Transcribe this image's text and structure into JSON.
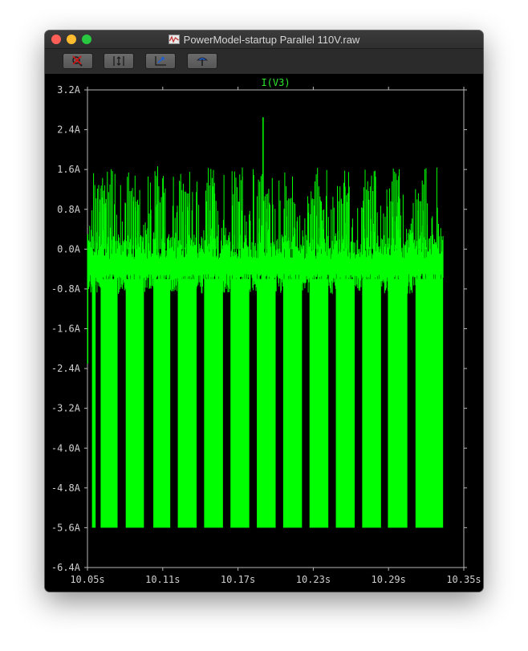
{
  "window": {
    "title": "PowerModel-startup Parallel 110V.raw"
  },
  "toolbar": {
    "buttons": [
      {
        "icon": "zoom-cancel-icon"
      },
      {
        "icon": "autoscale-icon"
      },
      {
        "icon": "pan-icon"
      },
      {
        "icon": "probe-icon"
      }
    ]
  },
  "chart_data": {
    "type": "line",
    "title": "I(V3)",
    "xlabel": "",
    "ylabel": "",
    "xlim": [
      10.05,
      10.35
    ],
    "ylim": [
      -6.4,
      3.2
    ],
    "x_ticks": [
      "10.05s",
      "10.11s",
      "10.17s",
      "10.23s",
      "10.29s",
      "10.35s"
    ],
    "y_ticks": [
      "3.2A",
      "2.4A",
      "1.6A",
      "0.8A",
      "0.0A",
      "-0.8A",
      "-1.6A",
      "-2.4A",
      "-3.2A",
      "-4.0A",
      "-4.8A",
      "-5.6A",
      "-6.4A"
    ],
    "grid": false,
    "series": [
      {
        "name": "I(V3)",
        "color": "#00ff00",
        "x": [
          10.05,
          10.0536,
          10.0565,
          10.074,
          10.0744,
          10.0805,
          10.095,
          10.0954,
          10.1025,
          10.116,
          10.1164,
          10.122,
          10.137,
          10.1374,
          10.143,
          10.158,
          10.1584,
          10.164,
          10.179,
          10.1794,
          10.185,
          10.2,
          10.2004,
          10.206,
          10.221,
          10.2214,
          10.227,
          10.242,
          10.2424,
          10.248,
          10.263,
          10.2634,
          10.269,
          10.284,
          10.2844,
          10.2895,
          10.305,
          10.3054,
          10.3115,
          10.3335
        ],
        "y": [
          -2.3,
          1.5,
          -5.6,
          1.7,
          -0.5,
          -5.6,
          1.8,
          -0.6,
          -5.6,
          1.8,
          -0.7,
          -5.6,
          1.6,
          -0.7,
          -5.6,
          1.6,
          -0.7,
          -5.6,
          2.65,
          -0.7,
          -5.6,
          1.6,
          -0.7,
          -5.6,
          1.7,
          -0.7,
          -5.6,
          1.5,
          -0.7,
          -5.6,
          1.5,
          -0.7,
          -5.6,
          1.4,
          -0.7,
          -5.6,
          1.6,
          -0.7,
          -5.6,
          0.2
        ],
        "burst_windows": [
          [
            10.0536,
            10.0565
          ],
          [
            10.0605,
            10.074
          ],
          [
            10.0805,
            10.095
          ],
          [
            10.1025,
            10.116
          ],
          [
            10.122,
            10.137
          ],
          [
            10.143,
            10.158
          ],
          [
            10.164,
            10.179
          ],
          [
            10.185,
            10.2
          ],
          [
            10.206,
            10.221
          ],
          [
            10.227,
            10.242
          ],
          [
            10.248,
            10.263
          ],
          [
            10.269,
            10.284
          ],
          [
            10.2895,
            10.305
          ],
          [
            10.3115,
            10.3335
          ]
        ],
        "peak": {
          "x": 10.19,
          "y": 2.65
        },
        "min": -5.6
      }
    ]
  }
}
